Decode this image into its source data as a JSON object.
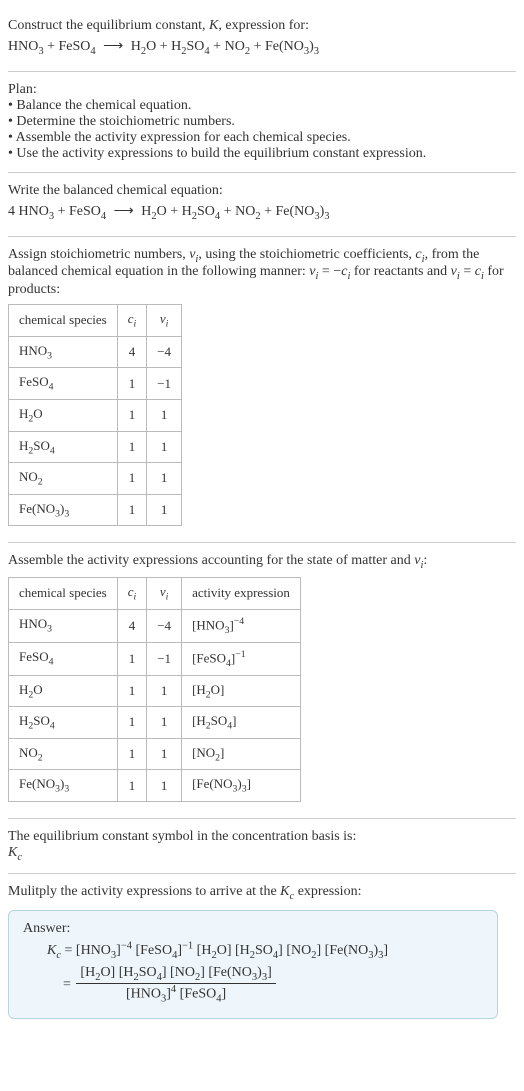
{
  "intro": {
    "line1_pre": "Construct the equilibrium constant, ",
    "line1_K": "K",
    "line1_post": ", expression for:",
    "eq_lhs_1": "HNO",
    "eq_lhs_1_sub": "3",
    "plus": " + ",
    "eq_lhs_2": "FeSO",
    "eq_lhs_2_sub": "4",
    "arrow": "⟶",
    "eq_rhs_1": "H",
    "eq_rhs_1_sub": "2",
    "eq_rhs_1b": "O",
    "eq_rhs_2": "H",
    "eq_rhs_2_sub": "2",
    "eq_rhs_2b": "SO",
    "eq_rhs_2b_sub": "4",
    "eq_rhs_3": "NO",
    "eq_rhs_3_sub": "2",
    "eq_rhs_4": "Fe(NO",
    "eq_rhs_4_sub": "3",
    "eq_rhs_4b": ")",
    "eq_rhs_4c_sub": "3"
  },
  "plan": {
    "title": "Plan:",
    "b1": "• Balance the chemical equation.",
    "b2": "• Determine the stoichiometric numbers.",
    "b3": "• Assemble the activity expression for each chemical species.",
    "b4": "• Use the activity expressions to build the equilibrium constant expression."
  },
  "balanced": {
    "title": "Write the balanced chemical equation:",
    "coef1": "4 ",
    "sp1": "HNO",
    "sp1_sub": "3",
    "sp2": "FeSO",
    "sp2_sub": "4",
    "sp3a": "H",
    "sp3a_sub": "2",
    "sp3b": "O",
    "sp4a": "H",
    "sp4a_sub": "2",
    "sp4b": "SO",
    "sp4b_sub": "4",
    "sp5": "NO",
    "sp5_sub": "2",
    "sp6a": "Fe(NO",
    "sp6a_sub": "3",
    "sp6b": ")",
    "sp6b_sub": "3"
  },
  "stoich": {
    "desc_1": "Assign stoichiometric numbers, ",
    "nu": "ν",
    "nu_sub": "i",
    "desc_2": ", using the stoichiometric coefficients, ",
    "c": "c",
    "c_sub": "i",
    "desc_3": ", from the balanced chemical equation in the following manner: ",
    "rel_react_lhs": "ν",
    "rel_react_lhs_sub": "i",
    "eq": " = ",
    "neg": "−",
    "rel_react_rhs": "c",
    "rel_react_rhs_sub": "i",
    "desc_4": " for reactants and ",
    "rel_prod_lhs": "ν",
    "rel_prod_lhs_sub": "i",
    "rel_prod_rhs": "c",
    "rel_prod_rhs_sub": "i",
    "desc_5": " for products:",
    "h_species": "chemical species",
    "h_c": "c",
    "h_c_sub": "i",
    "h_nu": "ν",
    "h_nu_sub": "i",
    "rows": [
      {
        "sp_a": "HNO",
        "sp_a_sub": "3",
        "sp_b": "",
        "sp_b_sub": "",
        "sp_c": "",
        "sp_c_sub": "",
        "c": "4",
        "nu": "−4"
      },
      {
        "sp_a": "FeSO",
        "sp_a_sub": "4",
        "sp_b": "",
        "sp_b_sub": "",
        "sp_c": "",
        "sp_c_sub": "",
        "c": "1",
        "nu": "−1"
      },
      {
        "sp_a": "H",
        "sp_a_sub": "2",
        "sp_b": "O",
        "sp_b_sub": "",
        "sp_c": "",
        "sp_c_sub": "",
        "c": "1",
        "nu": "1"
      },
      {
        "sp_a": "H",
        "sp_a_sub": "2",
        "sp_b": "SO",
        "sp_b_sub": "4",
        "sp_c": "",
        "sp_c_sub": "",
        "c": "1",
        "nu": "1"
      },
      {
        "sp_a": "NO",
        "sp_a_sub": "2",
        "sp_b": "",
        "sp_b_sub": "",
        "sp_c": "",
        "sp_c_sub": "",
        "c": "1",
        "nu": "1"
      },
      {
        "sp_a": "Fe(NO",
        "sp_a_sub": "3",
        "sp_b": ")",
        "sp_b_sub": "3",
        "sp_c": "",
        "sp_c_sub": "",
        "c": "1",
        "nu": "1"
      }
    ]
  },
  "activity": {
    "desc_1": "Assemble the activity expressions accounting for the state of matter and ",
    "nu": "ν",
    "nu_sub": "i",
    "desc_2": ":",
    "h_species": "chemical species",
    "h_c": "c",
    "h_c_sub": "i",
    "h_nu": "ν",
    "h_nu_sub": "i",
    "h_act": "activity expression",
    "rows": [
      {
        "sp_a": "HNO",
        "sp_a_sub": "3",
        "sp_b": "",
        "sp_b_sub": "",
        "sp_c": "",
        "sp_c_sub": "",
        "c": "4",
        "nu": "−4",
        "act_a": "[HNO",
        "act_a_sub": "3",
        "act_b": "]",
        "act_sup": "−4"
      },
      {
        "sp_a": "FeSO",
        "sp_a_sub": "4",
        "sp_b": "",
        "sp_b_sub": "",
        "sp_c": "",
        "sp_c_sub": "",
        "c": "1",
        "nu": "−1",
        "act_a": "[FeSO",
        "act_a_sub": "4",
        "act_b": "]",
        "act_sup": "−1"
      },
      {
        "sp_a": "H",
        "sp_a_sub": "2",
        "sp_b": "O",
        "sp_b_sub": "",
        "sp_c": "",
        "sp_c_sub": "",
        "c": "1",
        "nu": "1",
        "act_a": "[H",
        "act_a_sub": "2",
        "act_b": "O]",
        "act_sup": ""
      },
      {
        "sp_a": "H",
        "sp_a_sub": "2",
        "sp_b": "SO",
        "sp_b_sub": "4",
        "sp_c": "",
        "sp_c_sub": "",
        "c": "1",
        "nu": "1",
        "act_a": "[H",
        "act_a_sub": "2",
        "act_b": "SO",
        "act_b_sub": "4",
        "act_c": "]",
        "act_sup": ""
      },
      {
        "sp_a": "NO",
        "sp_a_sub": "2",
        "sp_b": "",
        "sp_b_sub": "",
        "sp_c": "",
        "sp_c_sub": "",
        "c": "1",
        "nu": "1",
        "act_a": "[NO",
        "act_a_sub": "2",
        "act_b": "]",
        "act_sup": ""
      },
      {
        "sp_a": "Fe(NO",
        "sp_a_sub": "3",
        "sp_b": ")",
        "sp_b_sub": "3",
        "sp_c": "",
        "sp_c_sub": "",
        "c": "1",
        "nu": "1",
        "act_a": "[Fe(NO",
        "act_a_sub": "3",
        "act_b": ")",
        "act_b_sub": "3",
        "act_c": "]",
        "act_sup": ""
      }
    ]
  },
  "symbol": {
    "line1": "The equilibrium constant symbol in the concentration basis is:",
    "K": "K",
    "K_sub": "c"
  },
  "final": {
    "title_1": "Mulitply the activity expressions to arrive at the ",
    "K": "K",
    "K_sub": "c",
    "title_2": " expression:"
  },
  "answer": {
    "label": "Answer:",
    "Kc_K": "K",
    "Kc_sub": "c",
    "eq": " = ",
    "t1_a": "[HNO",
    "t1_a_sub": "3",
    "t1_b": "]",
    "t1_sup": "−4",
    "t2_a": "[FeSO",
    "t2_a_sub": "4",
    "t2_b": "]",
    "t2_sup": "−1",
    "t3_a": "[H",
    "t3_a_sub": "2",
    "t3_b": "O]",
    "t4_a": "[H",
    "t4_a_sub": "2",
    "t4_b": "SO",
    "t4_b_sub": "4",
    "t4_c": "]",
    "t5_a": "[NO",
    "t5_a_sub": "2",
    "t5_b": "]",
    "t6_a": "[Fe(NO",
    "t6_a_sub": "3",
    "t6_b": ")",
    "t6_b_sub": "3",
    "t6_c": "]",
    "eq2": " = ",
    "num_a": "[H",
    "num_a_sub": "2",
    "num_b": "O] [H",
    "num_b_sub": "2",
    "num_c": "SO",
    "num_c_sub": "4",
    "num_d": "] [NO",
    "num_d_sub": "2",
    "num_e": "] [Fe(NO",
    "num_e_sub": "3",
    "num_f": ")",
    "num_f_sub": "3",
    "num_g": "]",
    "den_a": "[HNO",
    "den_a_sub": "3",
    "den_b": "]",
    "den_sup": "4",
    "den_c": " [FeSO",
    "den_c_sub": "4",
    "den_d": "]"
  }
}
